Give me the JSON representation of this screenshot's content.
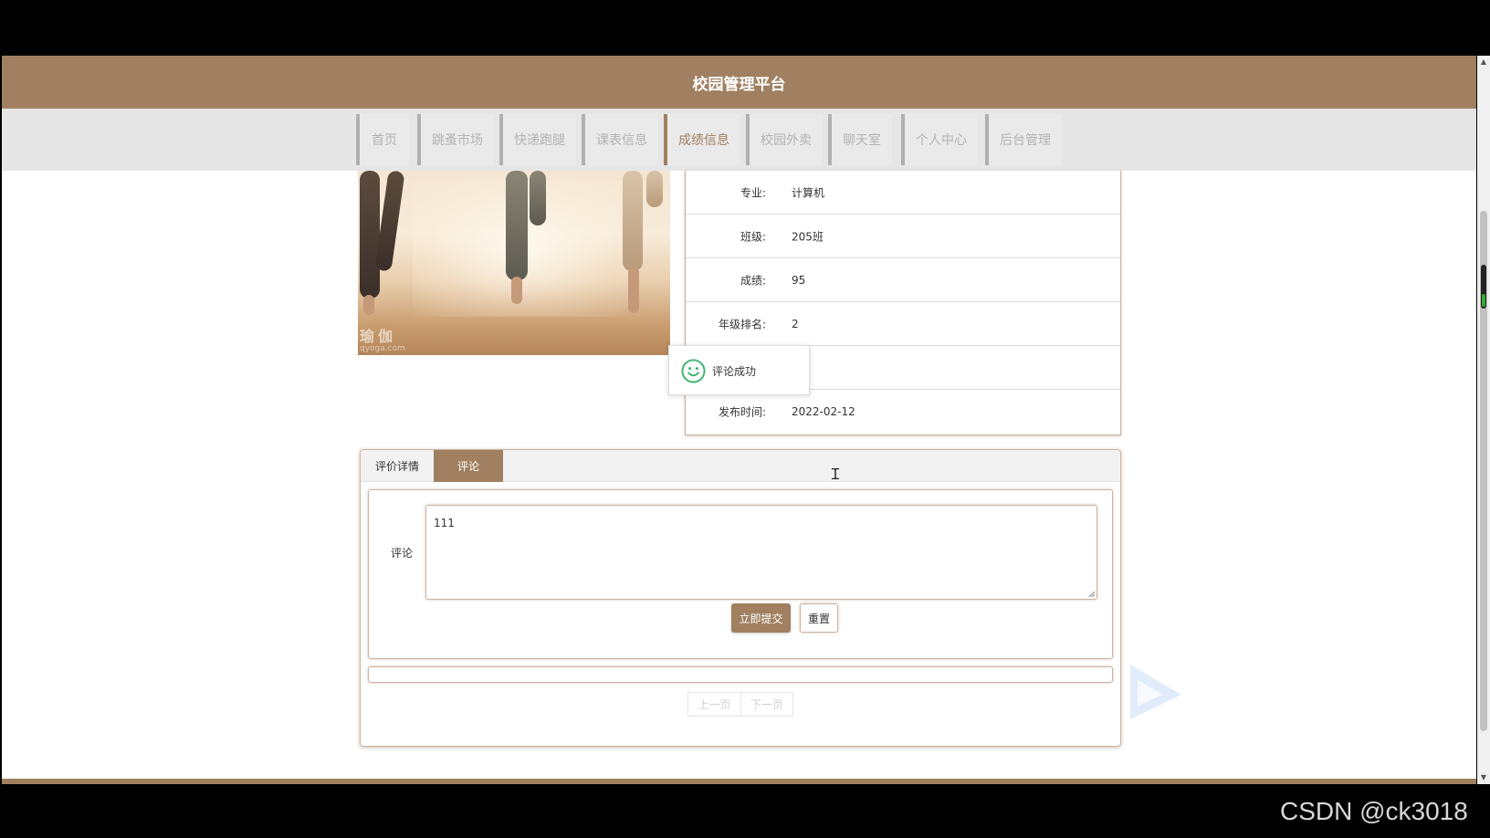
{
  "header": {
    "title": "校园管理平台"
  },
  "nav": {
    "items": [
      {
        "label": "首页"
      },
      {
        "label": "跳蚤市场"
      },
      {
        "label": "快递跑腿"
      },
      {
        "label": "课表信息"
      },
      {
        "label": "成绩信息"
      },
      {
        "label": "校园外卖"
      },
      {
        "label": "聊天室"
      },
      {
        "label": "个人中心"
      },
      {
        "label": "后台管理"
      }
    ],
    "active": "成绩信息"
  },
  "photo": {
    "watermark": "瑜伽",
    "watermark_url": "qyoga.com"
  },
  "details": {
    "rows": [
      {
        "label": "专业:",
        "value": "计算机"
      },
      {
        "label": "班级:",
        "value": "205班"
      },
      {
        "label": "成绩:",
        "value": "95"
      },
      {
        "label": "年级排名:",
        "value": "2"
      },
      {
        "label": "",
        "value": ""
      },
      {
        "label": "发布时间:",
        "value": "2022-02-12"
      }
    ]
  },
  "toast": {
    "message": "评论成功",
    "icon": "smile-icon"
  },
  "tabs": {
    "items": [
      {
        "label": "评价详情"
      },
      {
        "label": "评论"
      }
    ],
    "active": "评论"
  },
  "comment_form": {
    "label": "评论",
    "value": "111",
    "submit_label": "立即提交",
    "reset_label": "重置"
  },
  "pager": {
    "prev_label": "上一页",
    "next_label": "下一页"
  },
  "watermark_overlay": "CSDN @ck3018",
  "colors": {
    "brand": "#a08060",
    "nav_bg": "#e6e6e6",
    "nav_text": "#b3b3b3"
  }
}
